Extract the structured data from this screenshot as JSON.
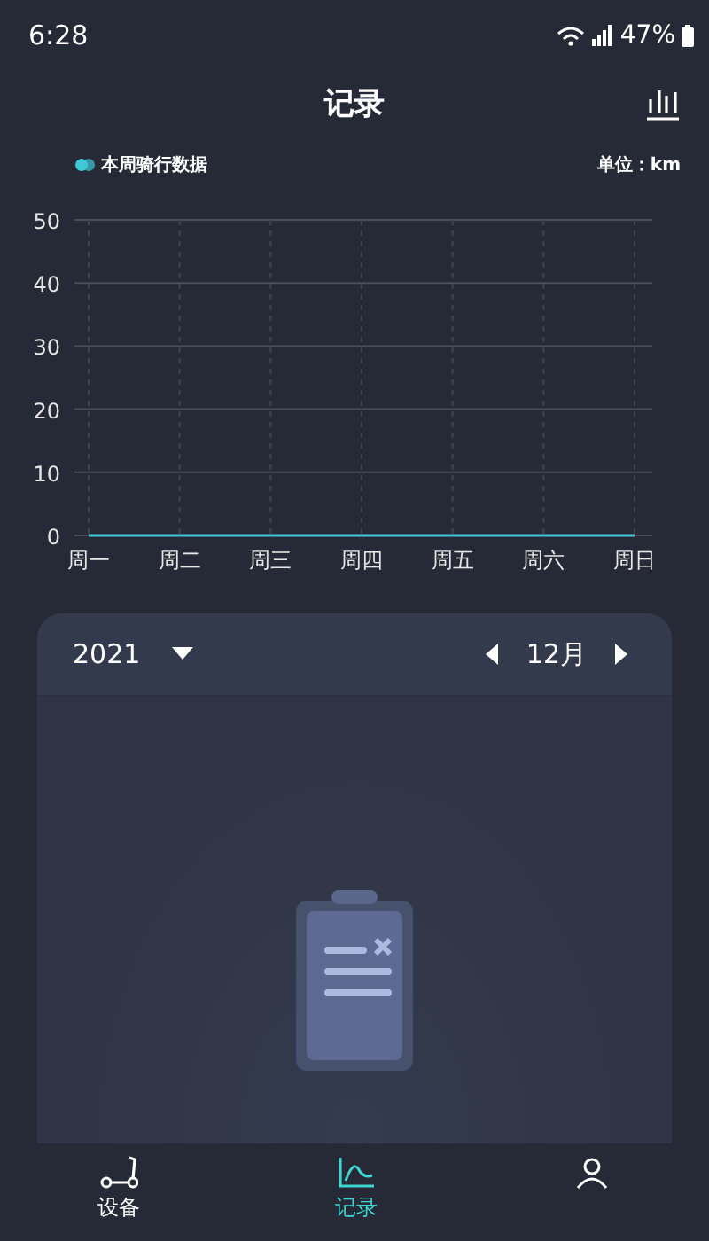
{
  "status_bar": {
    "time": "6:28",
    "battery": "47%"
  },
  "header": {
    "title": "记录"
  },
  "chart_panel": {
    "unit": "单位：km",
    "chart_data": {
      "type": "line",
      "grid": true,
      "categories": [
        "周一",
        "周二",
        "周三",
        "周四",
        "周五",
        "周六",
        "周日"
      ],
      "ylim": [
        0,
        50
      ],
      "yticks": [
        0,
        10,
        20,
        30,
        40,
        50
      ],
      "series": [
        {
          "name": "本周骑行数据",
          "color": "#3fc8d6",
          "values": [
            0,
            0,
            0,
            0,
            0,
            0,
            0
          ]
        }
      ]
    }
  },
  "records_card": {
    "year": "2021",
    "month": "12月"
  },
  "bottom_nav": [
    {
      "label": "设备",
      "selected": false
    },
    {
      "label": "记录",
      "selected": true
    },
    {
      "selected": false
    }
  ]
}
